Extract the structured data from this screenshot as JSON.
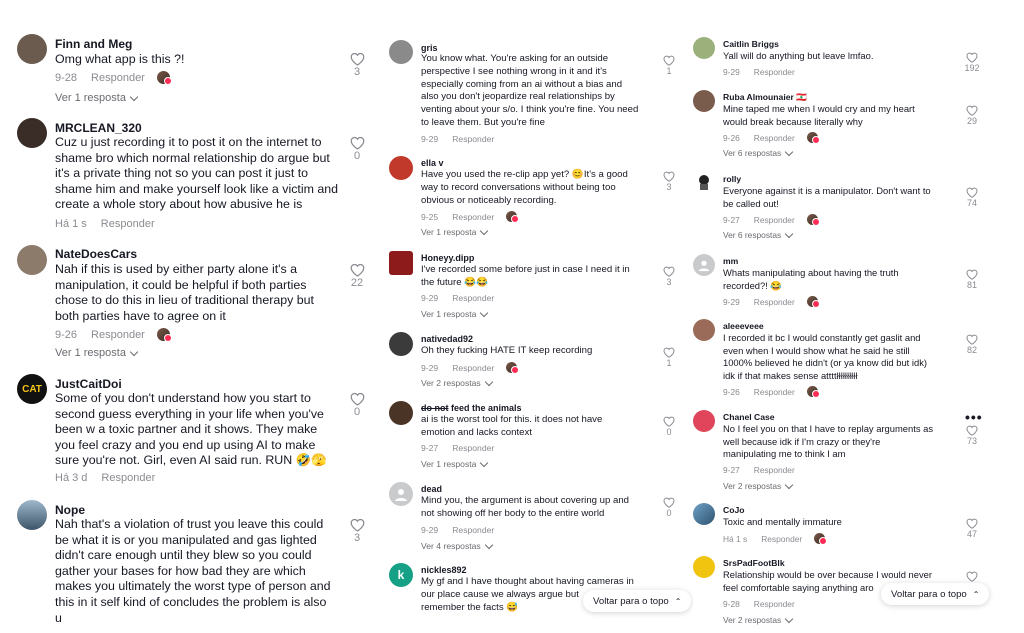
{
  "ui": {
    "respond_label": "Responder",
    "back_to_top": "Voltar para o topo"
  },
  "col1": [
    {
      "user": "Finn and Meg",
      "text": "Omg what app is this ?!",
      "date": "9-28",
      "likes": "3",
      "replies": "Ver 1 resposta",
      "avatar_color": "#6b5b4e"
    },
    {
      "user": "MRCLEAN_320",
      "text": "Cuz u just recording it to post it on the internet to\nshame bro which normal relationship do argue but\nit's a private thing not so you can post it just to\nshame him and make yourself look like a victim and\ncreate a whole story about how abusive he is",
      "date": "Há 1 s",
      "likes": "0",
      "replies": "",
      "avatar_color": "#3a2c26"
    },
    {
      "user": "NateDoesCars",
      "text": "Nah if this is used by either party alone it's a\nmanipulation, it could be helpful if both parties\nchose to do this in lieu of traditional therapy but\nboth parties have to agree on it",
      "date": "9-26",
      "likes": "22",
      "replies": "Ver 1 resposta",
      "avatar_color": "#8c7a6a"
    },
    {
      "user": "JustCaitDoi",
      "text": "Some of you don't understand how you start to\nsecond guess everything in your life when you've\nbeen w a toxic partner and it shows. They make\nyou feel crazy and you end up using AI to make\nsure you're not. Girl, even AI said run. RUN 🤣🫣",
      "date": "Há 3 d",
      "likes": "0",
      "replies": "",
      "avatar_color": "#111111",
      "avatar_text": "CAT"
    },
    {
      "user": "Nope",
      "text": "Nah that's a violation of trust you leave this could\nbe what it is or you manipulated and gas lighted\ndidn't care enough until they blew so you could\ngather your bases for how bad they are which\nmakes you ultimately the worst type of person and\nthis in it self kind of concludes the problem is also\nu",
      "date": "",
      "likes": "3",
      "replies": "",
      "avatar_color": "#5b7a95"
    }
  ],
  "col2": [
    {
      "user": "gris",
      "text": "You know what. You're asking for an outside\nperspective I see nothing wrong in it and it's\nespecially coming from an ai without a bias and\nalso you don't jeopardize real relationships by\nventing about your s/o. I think you're fine. You need\nto leave them. But you're fine",
      "date": "9-29",
      "likes": "1",
      "replies": "",
      "avatar_color": "#8a8a8a"
    },
    {
      "user": "ella v",
      "text": "Have you used the re-clip app yet? 😊It's a good\nway to record conversations without being too\nobvious or noticeably recording.",
      "date": "9-25",
      "likes": "3",
      "replies": "Ver 1 resposta",
      "avatar_color": "#c0392b"
    },
    {
      "user": "Honeyy.dipp",
      "text": "I've recorded some before just in case I need it in\nthe future 😂😂",
      "date": "9-29",
      "likes": "3",
      "replies": "Ver 1 resposta",
      "avatar_color": "#8e1b1b"
    },
    {
      "user": "nativedad92",
      "text": "Oh they fucking HATE IT keep recording",
      "date": "9-29",
      "likes": "1",
      "replies": "Ver 2 respostas",
      "avatar_color": "#3b3b3b"
    },
    {
      "user_strike": "do not",
      "user": " feed the animals",
      "text": "ai is the worst tool for this. it does not have\nemotion and lacks context",
      "date": "9-27",
      "likes": "0",
      "replies": "Ver 1 resposta",
      "avatar_color": "#4a3426"
    },
    {
      "user": "dead",
      "text": "Mind you, the argument is about covering up and\nnot showing off her body to the entire world",
      "date": "9-29",
      "likes": "0",
      "replies": "Ver 4 respostas",
      "avatar_color": "#c9cacc"
    },
    {
      "user": "nickles892",
      "text": "My gf and I have thought about having cameras in\nour place cause we always argue but\nremember the facts 😅",
      "date": "",
      "likes": "",
      "replies": "",
      "avatar_color": "#16a085",
      "avatar_text": "k"
    }
  ],
  "col3": [
    {
      "user": "Caitlin Briggs",
      "text": "Yall will do anything but leave lmfao.",
      "date": "9-29",
      "likes": "192",
      "replies": "",
      "avatar_color": "#9bb07a"
    },
    {
      "user": "Ruba Almounaier 🇱🇧",
      "text": "Mine taped me when I would cry and my heart\nwould break because literally why",
      "date": "9-26",
      "likes": "29",
      "replies": "Ver 6 respostas",
      "avatar_color": "#7a5c4c"
    },
    {
      "user": "rolly",
      "text": "Everyone against it is a manipulator. Don't want to\nbe called out!",
      "date": "9-27",
      "likes": "74",
      "replies": "Ver 6 respostas",
      "avatar_color": "#ffffff"
    },
    {
      "user": "mm",
      "text": "Whats manipulating about having the truth\nrecorded?! 😂",
      "date": "9-29",
      "likes": "81",
      "replies": "",
      "avatar_color": "#c9cacc"
    },
    {
      "user": "aleeeveee",
      "text": "I recorded it bc I would constantly get gaslit and\neven when I would show what he said he still\n1000% believed he didn't (or ya know did but idk)\nidk if that makes sense attttłłłłłłłłłł",
      "date": "9-26",
      "likes": "82",
      "replies": "",
      "avatar_color": "#9b6b5a"
    },
    {
      "user": "Chanel Case",
      "text": "No I feel you on that I have to replay arguments as\nwell because idk if I'm crazy or they're\nmanipulating me to think I am",
      "date": "9-27",
      "likes": "73",
      "replies": "Ver 2 respostas",
      "avatar_color": "#e0455b"
    },
    {
      "user": "CoJo",
      "text": "Toxic and mentally immature",
      "date": "Há 1 s",
      "likes": "47",
      "replies": "",
      "avatar_color": "#3a6f9a"
    },
    {
      "user": "SrsPadFootBlk",
      "text": "Relationship would be over because I would never\nfeel comfortable saying anything aro",
      "date": "9-28",
      "likes": "",
      "replies": "Ver 2 respostas",
      "avatar_color": "#f1c40f"
    }
  ]
}
